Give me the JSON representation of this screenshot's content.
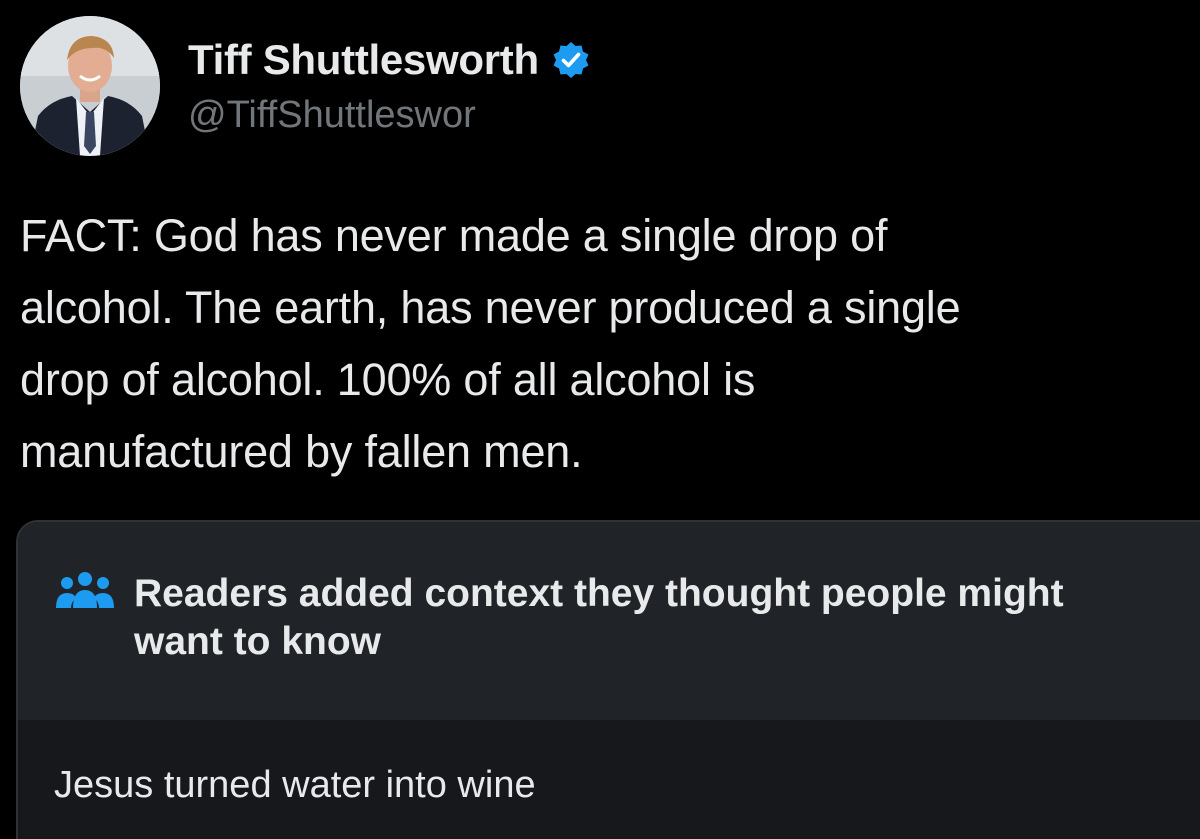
{
  "post": {
    "author": {
      "display_name": "Tiff Shuttlesworth",
      "handle": "@TiffShuttleswor",
      "avatar_icon": "profile-photo",
      "verified_icon": "verified-badge-icon",
      "verified_color": "#1d9bf0"
    },
    "text_lines": [
      "FACT: God has never made a single drop of",
      "alcohol. The earth, has never produced a single",
      "drop of alcohol. 100% of all alcohol is",
      "manufactured by fallen men."
    ]
  },
  "community_note": {
    "icon": "people-group-icon",
    "icon_color": "#1d9bf0",
    "title": "Readers added context they thought people might want to know",
    "body": "Jesus turned water into wine"
  },
  "colors": {
    "background": "#000000",
    "primary_text": "#e7e9ea",
    "secondary_text": "#71767b",
    "note_header_bg": "#202327",
    "note_body_bg": "#16181c"
  }
}
